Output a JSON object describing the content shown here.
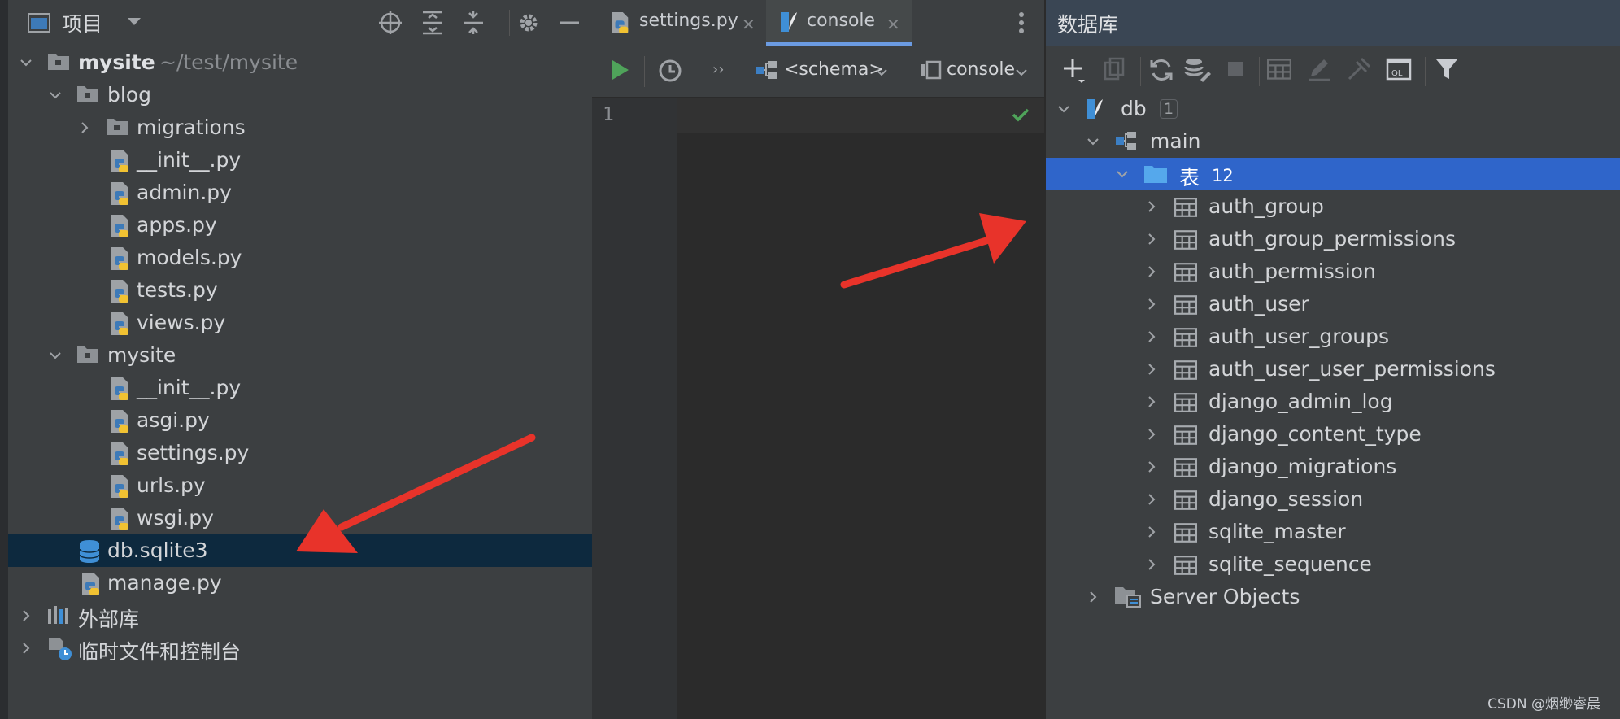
{
  "project": {
    "title": "项目",
    "tree": [
      {
        "label": "mysite",
        "sub": "~/test/mysite"
      },
      {
        "label": "blog"
      },
      {
        "label": "migrations"
      },
      {
        "label": "__init__.py"
      },
      {
        "label": "admin.py"
      },
      {
        "label": "apps.py"
      },
      {
        "label": "models.py"
      },
      {
        "label": "tests.py"
      },
      {
        "label": "views.py"
      },
      {
        "label": "mysite"
      },
      {
        "label": "__init__.py"
      },
      {
        "label": "asgi.py"
      },
      {
        "label": "settings.py"
      },
      {
        "label": "urls.py"
      },
      {
        "label": "wsgi.py"
      },
      {
        "label": "db.sqlite3"
      },
      {
        "label": "manage.py"
      },
      {
        "label": "外部库"
      },
      {
        "label": "临时文件和控制台"
      }
    ]
  },
  "editor": {
    "tabs": [
      {
        "label": "settings.py",
        "close": "✕"
      },
      {
        "label": "console",
        "close": "✕"
      }
    ],
    "schema_label": "<schema>",
    "console_label": "console",
    "more": "››",
    "line_number": "1"
  },
  "database": {
    "title": "数据库",
    "tree": [
      {
        "label": "db",
        "badge": "1"
      },
      {
        "label": "main"
      },
      {
        "label": "表",
        "count": "12"
      },
      {
        "label": "auth_group"
      },
      {
        "label": "auth_group_permissions"
      },
      {
        "label": "auth_permission"
      },
      {
        "label": "auth_user"
      },
      {
        "label": "auth_user_groups"
      },
      {
        "label": "auth_user_user_permissions"
      },
      {
        "label": "django_admin_log"
      },
      {
        "label": "django_content_type"
      },
      {
        "label": "django_migrations"
      },
      {
        "label": "django_session"
      },
      {
        "label": "sqlite_master"
      },
      {
        "label": "sqlite_sequence"
      },
      {
        "label": "Server Objects"
      }
    ]
  },
  "watermark": "CSDN @烟缈睿晨",
  "colors": {
    "selection_db": "#2f65ca",
    "selection_project": "#0d293e",
    "arrow": "#e8332a",
    "run": "#4fa35a",
    "accent_tab": "#6b9be2"
  },
  "icons": {
    "run": "play-icon",
    "history": "clock-icon",
    "settings": "gear-icon",
    "filter": "funnel-icon",
    "refresh": "refresh-icon"
  }
}
